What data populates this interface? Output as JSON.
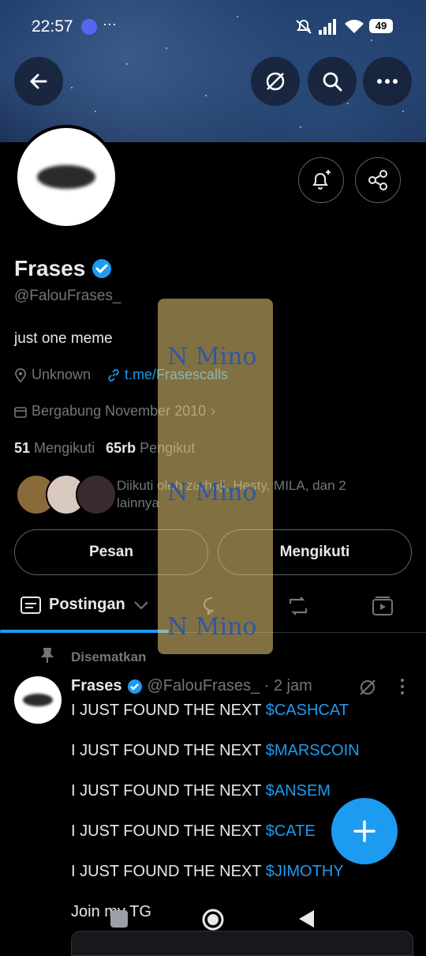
{
  "status": {
    "time": "22:57",
    "battery": "49"
  },
  "profile": {
    "name": "Frases",
    "handle": "@FalouFrases_",
    "bio": "just one meme",
    "location": "Unknown",
    "link": "t.me/Frasescalls",
    "joined": "Bergabung November 2010",
    "following_count": "51",
    "following_label": "Mengikuti",
    "followers_count": "65rb",
    "followers_label": "Pengikut",
    "followed_by_line1": "Diikuti oleh zarhaji, Hesty, MILA, dan 2",
    "followed_by_line2": "lainnya"
  },
  "actions": {
    "message": "Pesan",
    "follow": "Mengikuti"
  },
  "tabs": {
    "posts": "Postingan"
  },
  "watermark": "N Mino",
  "pinned": {
    "label": "Disematkan",
    "name": "Frases",
    "meta": "@FalouFrases_ · 2 jam",
    "prefix": "I JUST FOUND THE NEXT ",
    "tickers": [
      "$CASHCAT",
      "$MARSCOIN",
      "$ANSEM",
      "$CATE",
      "$JIMOTHY"
    ],
    "last_line": "Join my TG"
  },
  "colors": {
    "accent": "#1d9bf0",
    "background": "#000000"
  }
}
